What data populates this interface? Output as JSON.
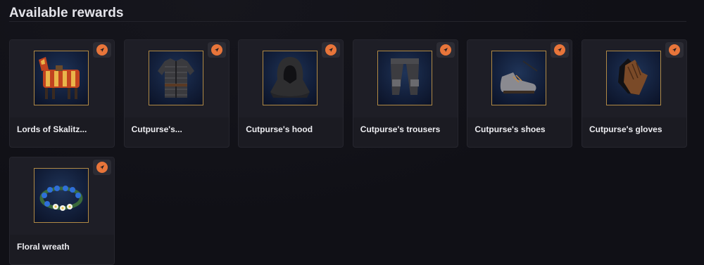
{
  "header": {
    "title": "Available rewards"
  },
  "rewards": [
    {
      "label": "Lords of Skalitz...",
      "icon": "horse-armor-icon"
    },
    {
      "label": "Cutpurse's...",
      "icon": "chainmail-shirt-icon"
    },
    {
      "label": "Cutpurse's hood",
      "icon": "hood-icon"
    },
    {
      "label": "Cutpurse's trousers",
      "icon": "trousers-icon"
    },
    {
      "label": "Cutpurse's shoes",
      "icon": "shoes-icon"
    },
    {
      "label": "Cutpurse's gloves",
      "icon": "gloves-icon"
    },
    {
      "label": "Floral wreath",
      "icon": "floral-wreath-icon"
    }
  ],
  "colors": {
    "accent": "#e8753a",
    "frame_border": "#b18a45",
    "card_bg": "#1b1b22",
    "page_bg": "#101016"
  }
}
